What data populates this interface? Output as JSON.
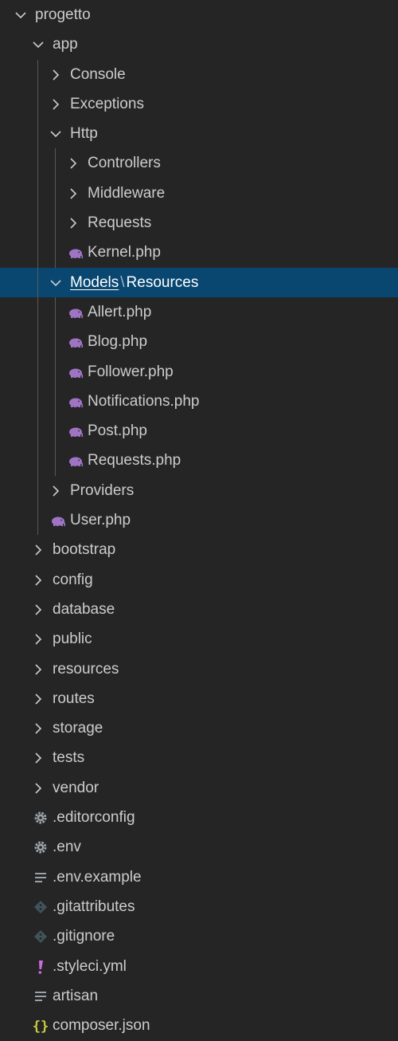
{
  "explorer": {
    "colors": {
      "background": "#252526",
      "selected": "#094771",
      "text": "#cccccc",
      "php": "#a074c4",
      "yaml": "#cb6cdb",
      "json": "#cbcb41",
      "settings": "#9aa1a8",
      "git": "#41535b",
      "textfile": "#9aa1a8"
    },
    "items": [
      {
        "type": "folder",
        "label": "progetto",
        "depth": 0,
        "open": true
      },
      {
        "type": "folder",
        "label": "app",
        "depth": 1,
        "open": true
      },
      {
        "type": "folder",
        "label": "Console",
        "depth": 2,
        "open": false
      },
      {
        "type": "folder",
        "label": "Exceptions",
        "depth": 2,
        "open": false
      },
      {
        "type": "folder",
        "label": "Http",
        "depth": 2,
        "open": true
      },
      {
        "type": "folder",
        "label": "Controllers",
        "depth": 3,
        "open": false
      },
      {
        "type": "folder",
        "label": "Middleware",
        "depth": 3,
        "open": false
      },
      {
        "type": "folder",
        "label": "Requests",
        "depth": 3,
        "open": false
      },
      {
        "type": "file",
        "label": "Kernel.php",
        "depth": 3,
        "icon": "php-elephant-icon"
      },
      {
        "type": "folder",
        "label": "Models",
        "label2": "Resources",
        "separator": "\\",
        "depth": 2,
        "open": true,
        "selected": true
      },
      {
        "type": "file",
        "label": "Allert.php",
        "depth": 3,
        "icon": "php-elephant-icon"
      },
      {
        "type": "file",
        "label": "Blog.php",
        "depth": 3,
        "icon": "php-elephant-icon"
      },
      {
        "type": "file",
        "label": "Follower.php",
        "depth": 3,
        "icon": "php-elephant-icon"
      },
      {
        "type": "file",
        "label": "Notifications.php",
        "depth": 3,
        "icon": "php-elephant-icon"
      },
      {
        "type": "file",
        "label": "Post.php",
        "depth": 3,
        "icon": "php-elephant-icon"
      },
      {
        "type": "file",
        "label": "Requests.php",
        "depth": 3,
        "icon": "php-elephant-icon"
      },
      {
        "type": "folder",
        "label": "Providers",
        "depth": 2,
        "open": false
      },
      {
        "type": "file",
        "label": "User.php",
        "depth": 2,
        "icon": "php-elephant-icon"
      },
      {
        "type": "folder",
        "label": "bootstrap",
        "depth": 1,
        "open": false
      },
      {
        "type": "folder",
        "label": "config",
        "depth": 1,
        "open": false
      },
      {
        "type": "folder",
        "label": "database",
        "depth": 1,
        "open": false
      },
      {
        "type": "folder",
        "label": "public",
        "depth": 1,
        "open": false
      },
      {
        "type": "folder",
        "label": "resources",
        "depth": 1,
        "open": false
      },
      {
        "type": "folder",
        "label": "routes",
        "depth": 1,
        "open": false
      },
      {
        "type": "folder",
        "label": "storage",
        "depth": 1,
        "open": false
      },
      {
        "type": "folder",
        "label": "tests",
        "depth": 1,
        "open": false
      },
      {
        "type": "folder",
        "label": "vendor",
        "depth": 1,
        "open": false
      },
      {
        "type": "file",
        "label": ".editorconfig",
        "depth": 1,
        "icon": "gear-icon"
      },
      {
        "type": "file",
        "label": ".env",
        "depth": 1,
        "icon": "gear-icon"
      },
      {
        "type": "file",
        "label": ".env.example",
        "depth": 1,
        "icon": "text-lines-icon"
      },
      {
        "type": "file",
        "label": ".gitattributes",
        "depth": 1,
        "icon": "git-diamond-icon"
      },
      {
        "type": "file",
        "label": ".gitignore",
        "depth": 1,
        "icon": "git-diamond-icon"
      },
      {
        "type": "file",
        "label": ".styleci.yml",
        "depth": 1,
        "icon": "exclamation-icon"
      },
      {
        "type": "file",
        "label": "artisan",
        "depth": 1,
        "icon": "text-lines-icon"
      },
      {
        "type": "file",
        "label": "composer.json",
        "depth": 1,
        "icon": "braces-icon"
      }
    ]
  }
}
